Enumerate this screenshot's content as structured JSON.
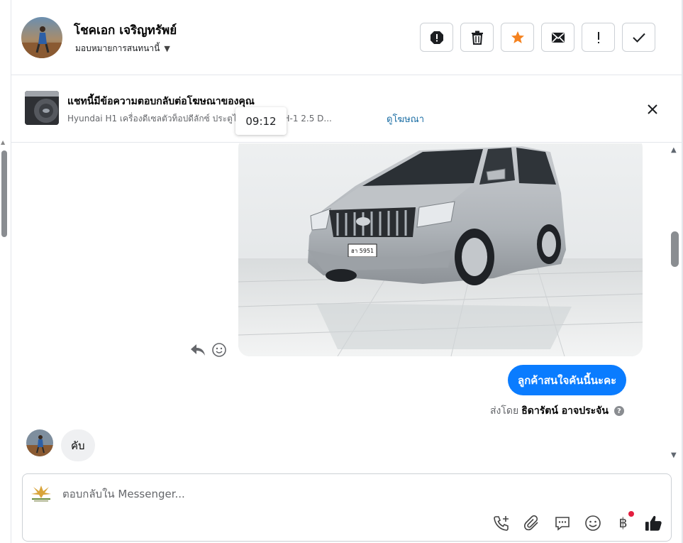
{
  "header": {
    "contact_name": "โชคเอก เจริญทรัพย์",
    "assign_label": "มอบหมายการสนทนานี้",
    "actions": [
      {
        "name": "spam-button",
        "icon": "alert-octagon-icon"
      },
      {
        "name": "delete-button",
        "icon": "trash-icon"
      },
      {
        "name": "star-button",
        "icon": "star-icon"
      },
      {
        "name": "mark-unread-button",
        "icon": "envelope-icon"
      },
      {
        "name": "follow-up-button",
        "icon": "exclamation-icon"
      },
      {
        "name": "mark-done-button",
        "icon": "check-icon"
      }
    ]
  },
  "ad_banner": {
    "title": "แชทนี้มีข้อความตอบกลับต่อโฆษณาของคุณ",
    "description": "Hyundai H1 เครื่องดีเซลตัวท็อปดีลักซ์ ประตูไฟฟ้า 2 ด้าน H-1 2.5 D...",
    "link_label": "ดูโฆษณา",
    "tooltip_time": "09:12"
  },
  "messages": {
    "outgoing_text": "ลูกค้าสนใจคันนี้นะคะ",
    "sent_by_prefix": "ส่งโดย",
    "sent_by_name": "ธิดารัตน์ อาจประจัน",
    "help_glyph": "?",
    "incoming_text": "คับ",
    "license_plate": "ฮา 5951"
  },
  "composer": {
    "placeholder": "ตอบกลับใน Messenger...",
    "value": "",
    "tools": [
      "call-add-icon",
      "attachment-icon",
      "saved-reply-icon",
      "emoji-icon",
      "payment-icon",
      "thumbs-up-icon"
    ],
    "payment_glyph": "฿"
  },
  "colors": {
    "accent_blue": "#0a7cff",
    "star_orange": "#f5821f",
    "notification_red": "#e41e3f",
    "link_blue": "#1d6fa5"
  }
}
